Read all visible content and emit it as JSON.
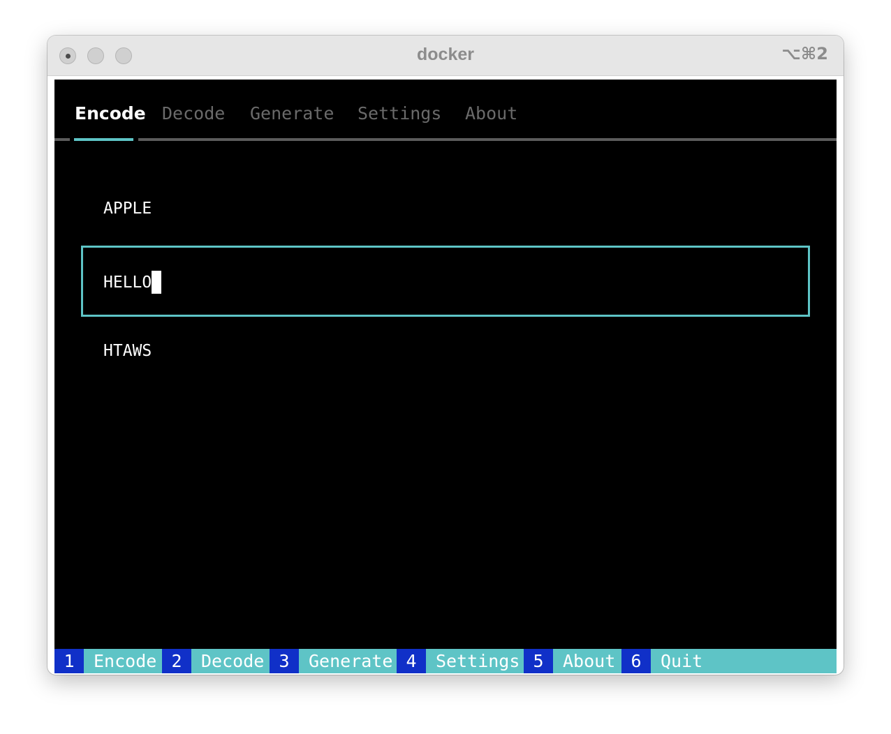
{
  "window": {
    "title": "docker",
    "shortcut": "⌥⌘2"
  },
  "tabs": [
    {
      "label": "Encode",
      "active": true
    },
    {
      "label": "Decode",
      "active": false
    },
    {
      "label": "Generate",
      "active": false
    },
    {
      "label": "Settings",
      "active": false
    },
    {
      "label": "About",
      "active": false
    }
  ],
  "encode": {
    "top_text": "APPLE",
    "input_value": "HELLO",
    "bottom_text": "HTAWS"
  },
  "footer": [
    {
      "key": "1",
      "label": "Encode"
    },
    {
      "key": "2",
      "label": "Decode"
    },
    {
      "key": "3",
      "label": "Generate"
    },
    {
      "key": "4",
      "label": "Settings"
    },
    {
      "key": "5",
      "label": "About"
    },
    {
      "key": "6",
      "label": "Quit"
    }
  ],
  "colors": {
    "accent": "#5ec4c6",
    "key_bg": "#1030c8",
    "terminal_bg": "#000000",
    "inactive_tab": "#6a6a6a"
  }
}
